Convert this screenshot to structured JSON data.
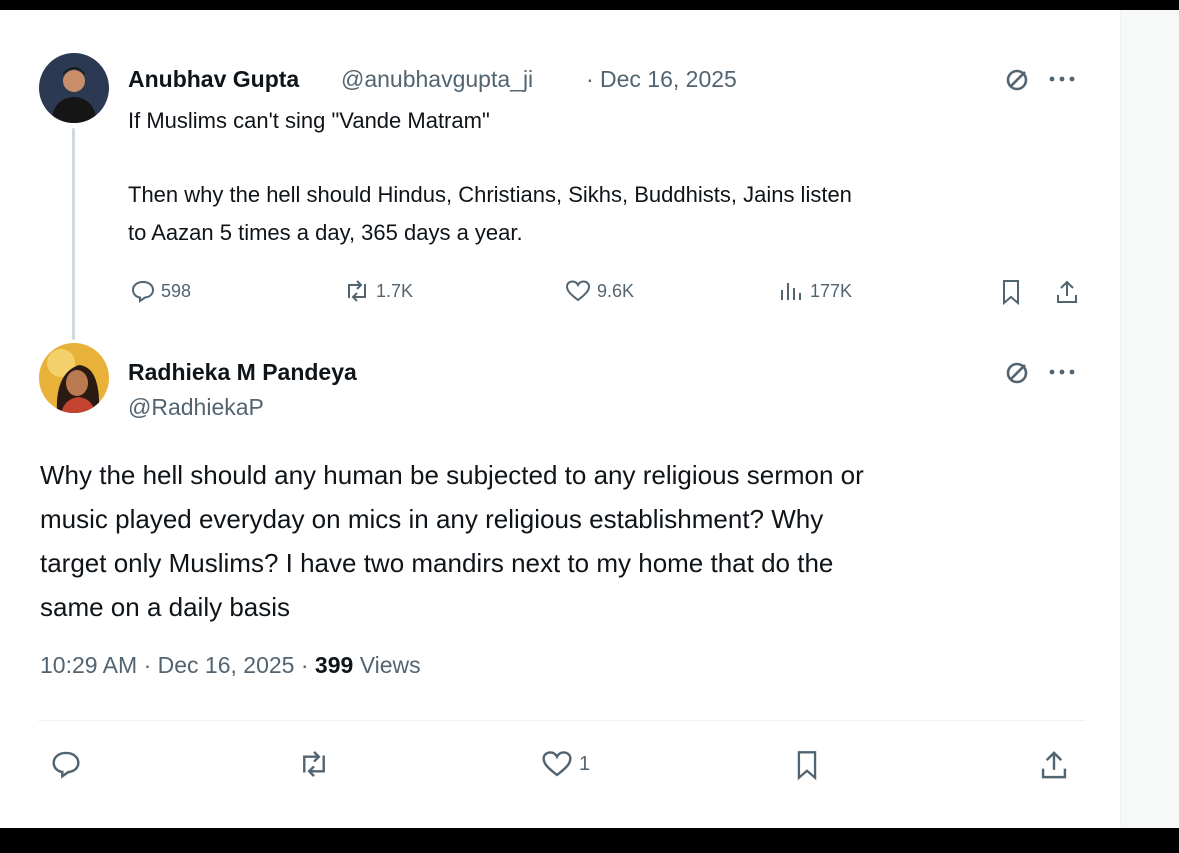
{
  "original_tweet": {
    "author_name": "Anubhav Gupta",
    "handle": "@anubhavgupta_ji",
    "separator": "·",
    "date": "Dec 16, 2025",
    "text_line1": "If Muslims can't sing \"Vande Matram\"",
    "text_line2": "Then why the hell should Hindus, Christians, Sikhs, Buddhists, Jains listen",
    "text_line3": "to Aazan 5 times a day, 365 days a year.",
    "stats": {
      "replies": "598",
      "reposts": "1.7K",
      "likes": "9.6K",
      "views": "177K"
    },
    "icons": [
      "grok-icon",
      "more-icon",
      "reply-icon",
      "repost-icon",
      "like-icon",
      "views-icon",
      "bookmark-icon",
      "share-icon"
    ]
  },
  "reply_tweet": {
    "author_name": "Radhieka M Pandeya",
    "handle": "@RadhiekaP",
    "text_line1": "Why the hell should any human be subjected to any religious sermon or",
    "text_line2": "music played everyday on mics in any religious establishment? Why",
    "text_line3": "target only Muslims? I have two mandirs next to my home that do the",
    "text_line4": "same on a daily basis",
    "time": "10:29 AM",
    "separator": "·",
    "date": "Dec 16, 2025",
    "views_count": "399",
    "views_label": "Views",
    "stats": {
      "likes": "1"
    },
    "icons": [
      "grok-icon",
      "more-icon",
      "reply-icon",
      "repost-icon",
      "like-icon",
      "bookmark-icon",
      "share-icon"
    ]
  },
  "colors": {
    "text_primary": "#0f1419",
    "text_secondary": "#536471",
    "divider": "#eff3f4",
    "thread_line": "#cfd9de",
    "background": "#ffffff",
    "frame": "#000000"
  }
}
